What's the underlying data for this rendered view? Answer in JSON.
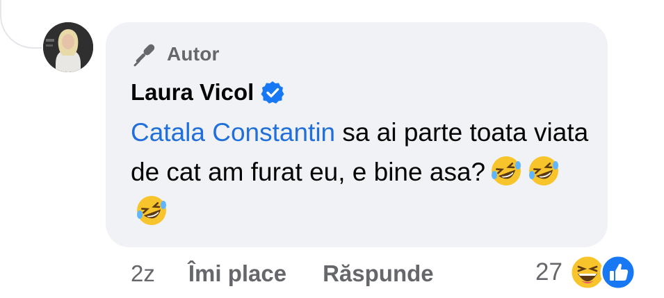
{
  "comment": {
    "role_label": "Autor",
    "author_name": "Laura Vicol",
    "mention": "Catala Constantin",
    "text": " sa ai parte toata viata de cat am furat eu, e bine asa?",
    "emojis": [
      "rolling-on-floor-laughing",
      "rolling-on-floor-laughing",
      "rolling-on-floor-laughing"
    ]
  },
  "actions": {
    "time": "2z",
    "like_label": "Îmi place",
    "reply_label": "Răspunde"
  },
  "reactions": {
    "count": "27",
    "types": [
      "haha",
      "like"
    ]
  },
  "colors": {
    "bubble": "#f0f2f5",
    "mention": "#216fdb",
    "secondary_text": "#65676b",
    "like_blue": "#1877f2"
  }
}
